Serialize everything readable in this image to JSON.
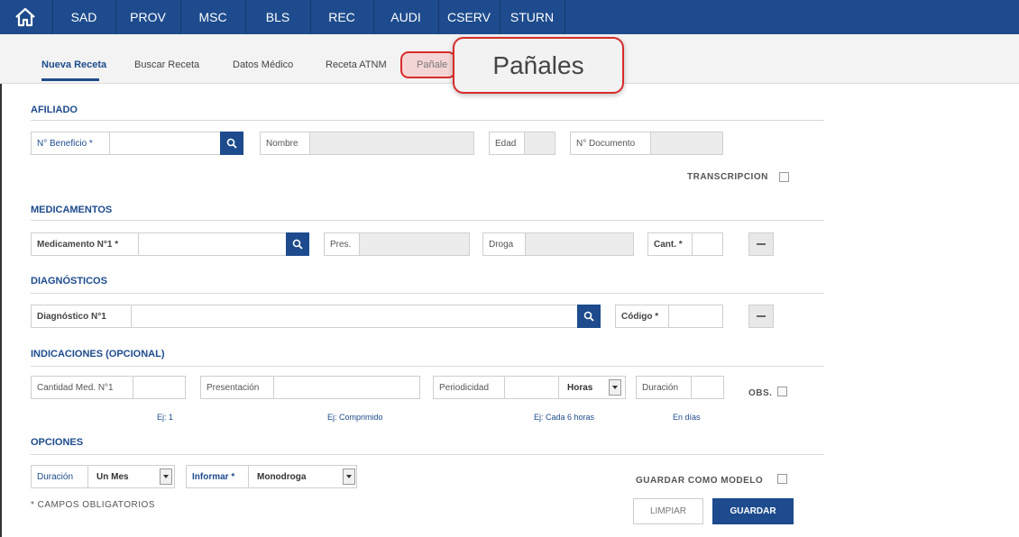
{
  "nav": {
    "items": [
      "SAD",
      "PROV",
      "MSC",
      "BLS",
      "REC",
      "AUDI",
      "CSERV",
      "STURN"
    ]
  },
  "subnav": {
    "tabs": [
      "Nueva Receta",
      "Buscar Receta",
      "Datos Médico",
      "Receta ATNM",
      "Pañale"
    ],
    "callout": "Pañales"
  },
  "afiliado": {
    "title": "AFILIADO",
    "beneficio_label": "N° Beneficio *",
    "nombre_label": "Nombre",
    "edad_label": "Edad",
    "documento_label": "N° Documento",
    "transcripcion_label": "TRANSCRIPCION"
  },
  "medicamentos": {
    "title": "MEDICAMENTOS",
    "medicamento_label": "Medicamento N°1 *",
    "pres_label": "Pres.",
    "droga_label": "Droga",
    "cant_label": "Cant. *"
  },
  "diagnosticos": {
    "title": "DIAGNÓSTICOS",
    "diagnostico_label": "Diagnóstico N°1",
    "codigo_label": "Código *"
  },
  "indicaciones": {
    "title": "INDICACIONES (OPCIONAL)",
    "cantidad_label": "Cantidad Med. N°1",
    "presentacion_label": "Presentación",
    "periodicidad_label": "Periodicidad",
    "periodicidad_unit": "Horas",
    "duracion_label": "Duración",
    "obs_label": "OBS.",
    "hint_cantidad": "Ej: 1",
    "hint_presentacion": "Ej: Comprimido",
    "hint_periodicidad": "Ej: Cada 6 horas",
    "hint_duracion": "En días"
  },
  "opciones": {
    "title": "OPCIONES",
    "duracion_label": "Duración",
    "duracion_value": "Un Mes",
    "informar_label": "Informar *",
    "informar_value": "Monodroga",
    "guardar_modelo_label": "GUARDAR COMO MODELO",
    "obligatorios_note": "* CAMPOS OBLIGATORIOS",
    "limpiar_label": "LIMPIAR",
    "guardar_label": "GUARDAR"
  },
  "colors": {
    "primary": "#1d4b8d",
    "highlight": "#d82c2c"
  }
}
